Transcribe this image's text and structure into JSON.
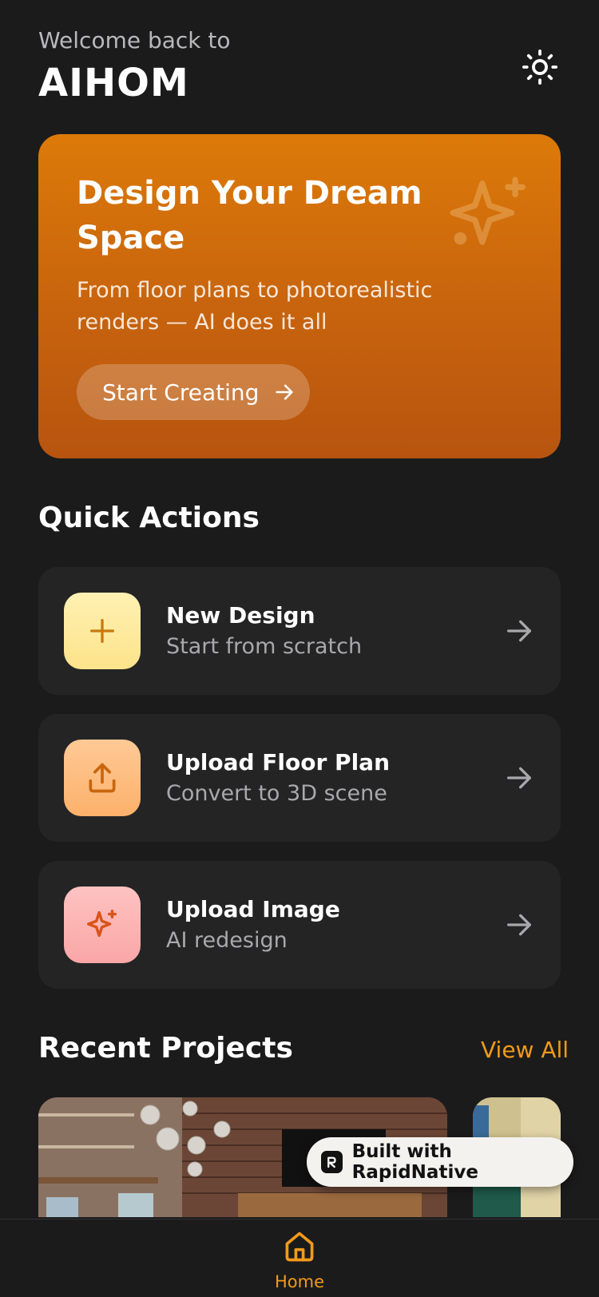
{
  "header": {
    "welcome_text": "Welcome back to",
    "brand": "AIHOM",
    "theme_icon": "sun-icon"
  },
  "hero": {
    "title": "Design Your Dream Space",
    "subtitle": "From floor plans to photorealistic renders — AI does it all",
    "button_label": "Start Creating",
    "decor_icon": "sparkle-icon",
    "gradient": [
      "#dc7a09",
      "#b7540f"
    ]
  },
  "quick_actions": {
    "title": "Quick Actions",
    "items": [
      {
        "title": "New Design",
        "subtitle": "Start from scratch",
        "icon": "plus-icon",
        "bg": "#fde89a",
        "fg": "#c77a0c"
      },
      {
        "title": "Upload Floor Plan",
        "subtitle": "Convert to 3D scene",
        "icon": "upload-icon",
        "bg": "#fdbd7e",
        "fg": "#c8650d"
      },
      {
        "title": "Upload Image",
        "subtitle": "AI redesign",
        "icon": "sparkle-icon",
        "bg": "#fbb4b2",
        "fg": "#d8541a"
      }
    ]
  },
  "recent_projects": {
    "title": "Recent Projects",
    "view_all": "View All"
  },
  "badge": {
    "label": "Built with RapidNative"
  },
  "tabbar": {
    "home_label": "Home",
    "home_icon": "home-icon"
  },
  "colors": {
    "accent": "#f29a1a",
    "background": "#1b1b1c",
    "card": "#242425"
  }
}
